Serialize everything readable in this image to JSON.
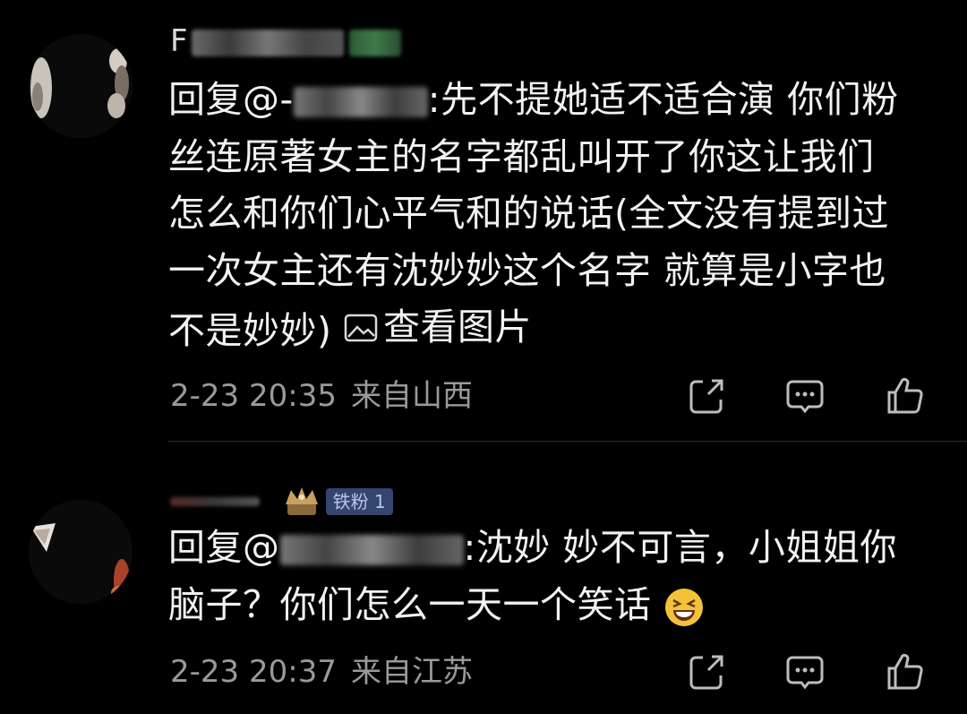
{
  "comments": [
    {
      "username_visible": "F",
      "mention_prefix": "回复@-",
      "mention_suffix": ":先不提她适不适合演 你们粉",
      "lines": [
        "丝连原著女主的名字都乱叫开了你这让我们",
        "怎么和你们心平气和的说话(全文没有提到过",
        "一次女主还有沈妙妙这个名字 就算是小字也"
      ],
      "last_line_text": "不是妙妙)",
      "view_image_label": "查看图片",
      "time": "2-23 20:35",
      "location": "来自山西"
    },
    {
      "fan_badge": "铁粉 1",
      "mention_prefix": "回复@",
      "mention_suffix": ":沈妙 妙不可言，小姐姐你",
      "line2": "脑子？你们怎么一天一个笑话",
      "time": "2-23 20:37",
      "location": "来自江苏"
    }
  ],
  "icons": {
    "share": "share-icon",
    "reply": "comment-icon",
    "like": "thumbs-up-icon",
    "image": "image-icon",
    "crown": "crown-icon",
    "laugh": "laughing-emoji-icon"
  }
}
